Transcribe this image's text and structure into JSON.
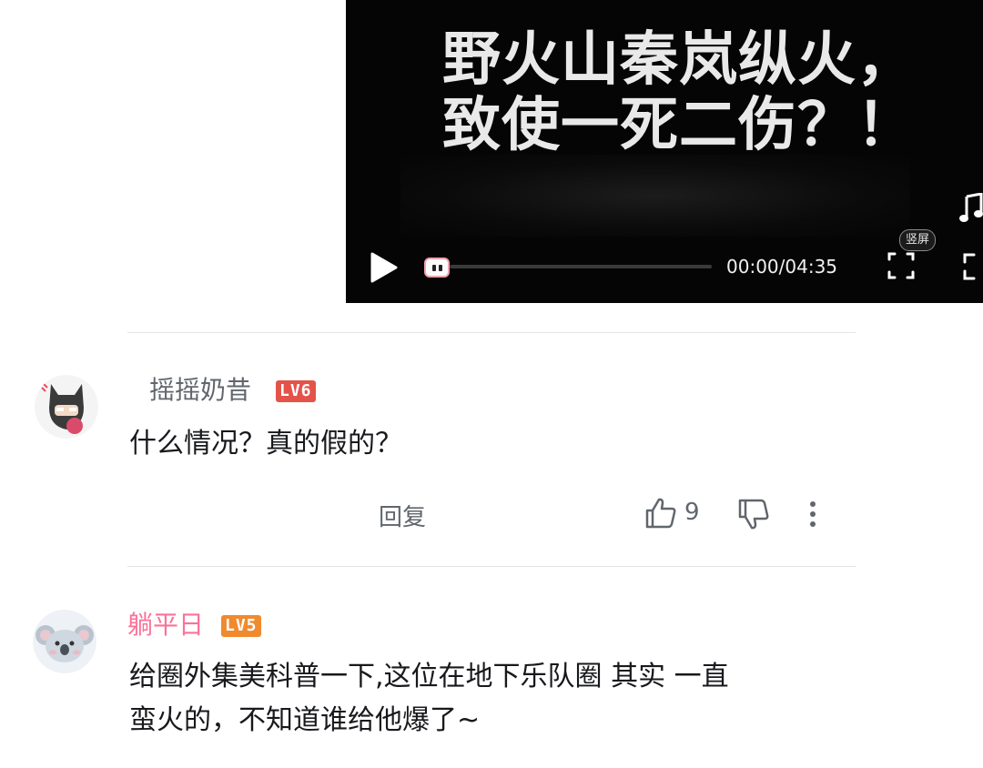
{
  "video": {
    "title": "野火山秦岚纵火，\n致使一死二伤？！",
    "time": "00:00/04:35",
    "vertical_label": "竖屏"
  },
  "comments": [
    {
      "username": "摇摇奶昔",
      "username_color": "#61666d",
      "level": "LV6",
      "level_color": "#e4534a",
      "content": "什么情况？真的假的？",
      "reply_label": "回复",
      "likes": "9"
    },
    {
      "username": "躺平日",
      "username_color": "#fb7299",
      "level": "LV5",
      "level_color": "#f08a2e",
      "content_lines": [
        "给圈外集美科普一下,这位在地下乐队圈 其实 一直",
        "蛮火的，不知道谁给他爆了~"
      ]
    }
  ],
  "icons": {
    "play": "play-icon",
    "music": "music-note-icon",
    "vertical": "vertical-screen-icon",
    "fullscreen": "fullscreen-icon",
    "like": "thumbs-up-icon",
    "dislike": "thumbs-down-icon",
    "more": "more-vertical-icon"
  }
}
